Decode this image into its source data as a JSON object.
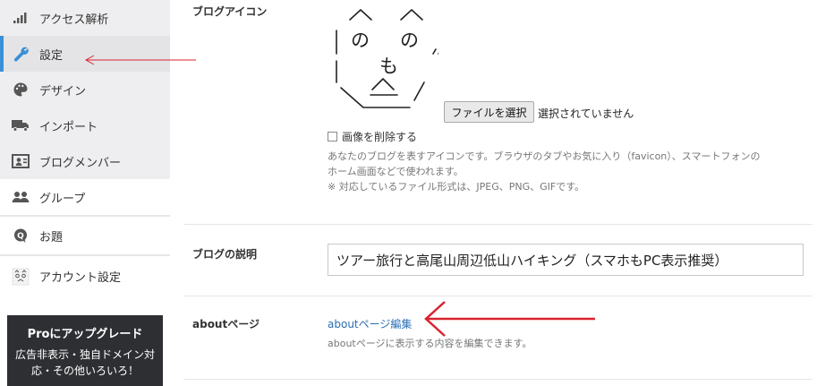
{
  "sidebar": {
    "items": [
      {
        "label": "アクセス解析",
        "icon": "bar-chart-icon"
      },
      {
        "label": "設定",
        "icon": "wrench-icon",
        "active": true
      },
      {
        "label": "デザイン",
        "icon": "palette-icon"
      },
      {
        "label": "インポート",
        "icon": "truck-icon"
      },
      {
        "label": "ブログメンバー",
        "icon": "member-card-icon"
      },
      {
        "label": "グループ",
        "icon": "group-icon"
      },
      {
        "label": "お題",
        "icon": "question-bubble-icon"
      },
      {
        "label": "アカウント設定",
        "icon": "avatar-face-icon"
      }
    ],
    "pro_banner": {
      "title": "Proにアップグレード",
      "text": "広告非表示・独自ドメイン対応・その他いろいろ！"
    }
  },
  "blog_icon": {
    "label": "ブログアイコン",
    "file_button": "ファイルを選択",
    "file_status": "選択されていません",
    "delete_label": "画像を削除する",
    "help_line1": "あなたのブログを表すアイコンです。ブラウザのタブやお気に入り（favicon）、スマートフォンの",
    "help_line2": "ホーム画面などで使われます。",
    "help_line3": "※ 対応しているファイル形式は、JPEG、PNG、GIFです。"
  },
  "blog_description": {
    "label": "ブログの説明",
    "value": "ツアー旅行と高尾山周辺低山ハイキング（スマホもPC表示推奨）"
  },
  "about_page": {
    "label": "aboutページ",
    "link": "aboutページ編集",
    "help": "aboutページに表示する内容を編集できます。"
  },
  "colors": {
    "accent": "#3a8fd6",
    "annotation_arrow": "#d9232f",
    "link": "#2a6eb5",
    "banner_bg": "#2d2f33"
  }
}
